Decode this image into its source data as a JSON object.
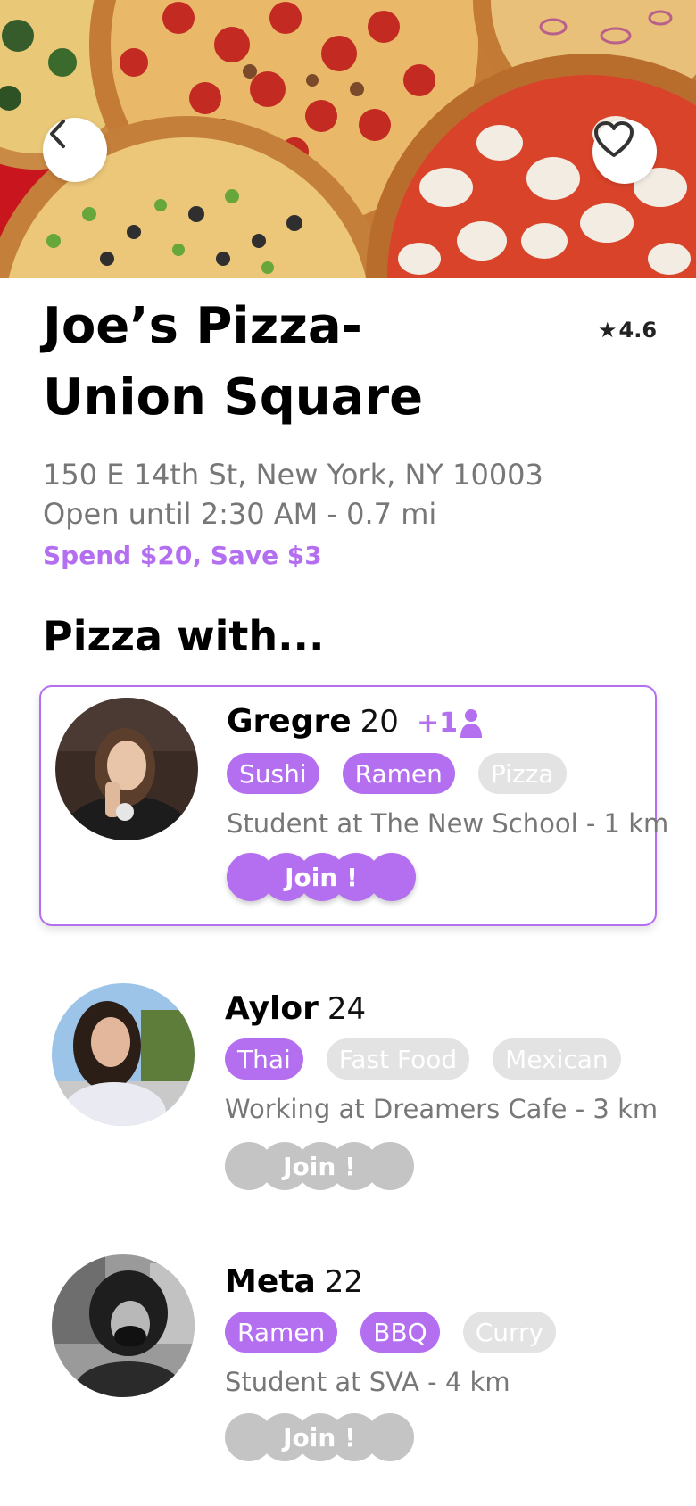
{
  "restaurant": {
    "name": "Joe’s Pizza- Union Square",
    "rating": "4.6",
    "address": "150 E 14th St, New York, NY 10003",
    "hours": "Open until 2:30 AM - 0.7 mi",
    "promo": "Spend $20, Save $3"
  },
  "section_title": "Pizza with...",
  "icons": {
    "back": "chevron-left-icon",
    "favorite": "heart-outline-icon",
    "star": "star-icon",
    "person": "person-icon"
  },
  "colors": {
    "accent": "#b46ff0",
    "tag_inactive": "#e3e3e3",
    "join_inactive": "#c4c4c4",
    "text_secondary": "#777777"
  },
  "people": [
    {
      "name": "Gregre",
      "age": "20",
      "plus": "+1",
      "tags": [
        {
          "label": "Sushi",
          "active": true
        },
        {
          "label": "Ramen",
          "active": true
        },
        {
          "label": "Pizza",
          "active": false
        }
      ],
      "description": "Student at The New School - 1 km",
      "join_label": "Join !",
      "join_active": true,
      "selected": true
    },
    {
      "name": "Aylor",
      "age": "24",
      "tags": [
        {
          "label": "Thai",
          "active": true
        },
        {
          "label": "Fast Food",
          "active": false
        },
        {
          "label": "Mexican",
          "active": false
        }
      ],
      "description": "Working at Dreamers Cafe - 3 km",
      "join_label": "Join !",
      "join_active": false
    },
    {
      "name": "Meta",
      "age": "22",
      "tags": [
        {
          "label": "Ramen",
          "active": true
        },
        {
          "label": "BBQ",
          "active": true
        },
        {
          "label": "Curry",
          "active": false
        }
      ],
      "description": "Student at SVA - 4 km",
      "join_label": "Join !",
      "join_active": false
    }
  ]
}
